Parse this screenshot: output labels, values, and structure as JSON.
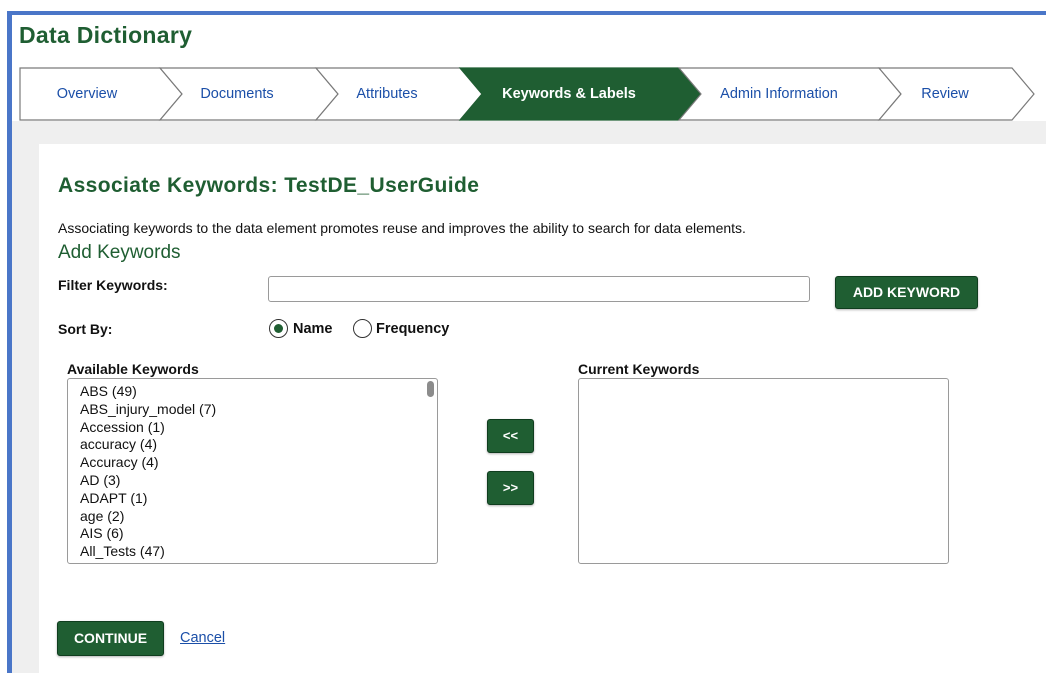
{
  "app": {
    "title": "Data Dictionary"
  },
  "steps": [
    {
      "label": "Overview",
      "active": false
    },
    {
      "label": "Documents",
      "active": false
    },
    {
      "label": "Attributes",
      "active": false
    },
    {
      "label": "Keywords & Labels",
      "active": true
    },
    {
      "label": "Admin Information",
      "active": false
    },
    {
      "label": "Review",
      "active": false
    }
  ],
  "page": {
    "heading": "Associate Keywords: TestDE_UserGuide",
    "description": "Associating keywords to the data element promotes reuse and improves the ability to search for data elements.",
    "subheading": "Add Keywords"
  },
  "filter": {
    "label": "Filter Keywords:",
    "value": "",
    "add_button": "ADD KEYWORD"
  },
  "sort": {
    "label": "Sort By:",
    "options": [
      {
        "label": "Name",
        "checked": true
      },
      {
        "label": "Frequency",
        "checked": false
      }
    ]
  },
  "available": {
    "title": "Available Keywords",
    "items": [
      "ABS (49)",
      "ABS_injury_model (7)",
      "Accession (1)",
      "accuracy (4)",
      "Accuracy (4)",
      "AD (3)",
      "ADAPT (1)",
      "age (2)",
      "AIS (6)",
      "All_Tests (47)"
    ]
  },
  "current": {
    "title": "Current Keywords",
    "items": []
  },
  "move": {
    "left": "<<",
    "right": ">>"
  },
  "footer": {
    "continue": "CONTINUE",
    "cancel": "Cancel"
  },
  "colors": {
    "brand_green": "#1f5e32",
    "link_blue": "#1b4fa8",
    "frame_blue": "#4a76c8"
  }
}
